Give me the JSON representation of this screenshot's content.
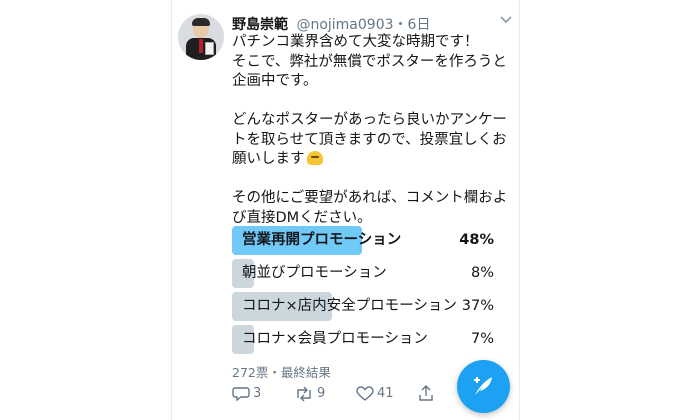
{
  "user": {
    "name": "野島崇範",
    "handle": "@nojima0903",
    "time": "6日"
  },
  "tweet": {
    "text": "パチンコ業界含めて大変な時期です！\nそこで、弊社が無償でポスターを作ろうと企画中です。\n\nどんなポスターがあったら良いかアンケートを取らせて頂きますので、投票宜しくお願いします",
    "text_2": "その他にご要望があれば、コメント欄および直接DMください。"
  },
  "poll": {
    "options": [
      {
        "label": "営業再開プロモーション",
        "percent": "48%",
        "fraction": 0.48,
        "winner": true
      },
      {
        "label": "朝並びプロモーション",
        "percent": "8%",
        "fraction": 0.08,
        "winner": false
      },
      {
        "label": "コロナ×店内安全プロモーション",
        "percent": "37%",
        "fraction": 0.37,
        "winner": false
      },
      {
        "label": "コロナ×会員プロモーション",
        "percent": "7%",
        "fraction": 0.07,
        "winner": false
      }
    ],
    "summary": "272票・最終結果"
  },
  "actions": {
    "reply_count": "3",
    "retweet_count": "9",
    "like_count": "41"
  },
  "icons": {
    "avatar": "profile-photo",
    "caret": "chevron-down-icon",
    "emoji": "pleading-emoji",
    "reply": "reply-icon",
    "retweet": "retweet-icon",
    "like": "heart-icon",
    "share": "share-icon",
    "compose": "compose-tweet-icon"
  },
  "colors": {
    "accent": "#1da1f2",
    "winner_bar": "#71c9f8",
    "bar": "#ccd6dd",
    "muted_text": "#657786"
  }
}
